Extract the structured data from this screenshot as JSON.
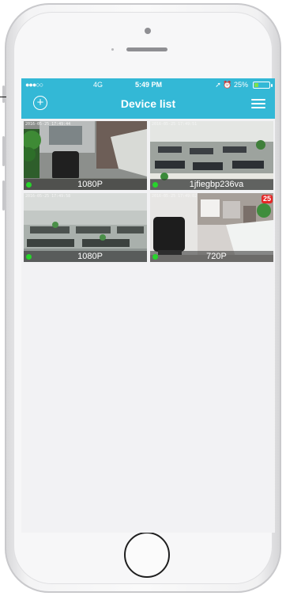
{
  "status_bar": {
    "signal": "●●●○○",
    "network": "4G",
    "time": "5:49 PM",
    "battery_text": "➚ ⏰ 25%",
    "battery_level": 0.25
  },
  "header": {
    "title": "Device list"
  },
  "devices": [
    {
      "label": "1080P",
      "online": true,
      "stamp": "2016-05-25 17:49:44",
      "badge": ""
    },
    {
      "label": "1jfiegbp236va",
      "online": true,
      "stamp": "2016-05-25 17:49:51",
      "badge": ""
    },
    {
      "label": "1080P",
      "online": true,
      "stamp": "2016-05-25 17:49:58",
      "badge": ""
    },
    {
      "label": "720P",
      "online": true,
      "stamp": "2016-05-25 17:49:02",
      "badge": "25"
    }
  ],
  "colors": {
    "navbar": "#33b8d6",
    "online": "#27d42b",
    "badge": "#e52626"
  }
}
